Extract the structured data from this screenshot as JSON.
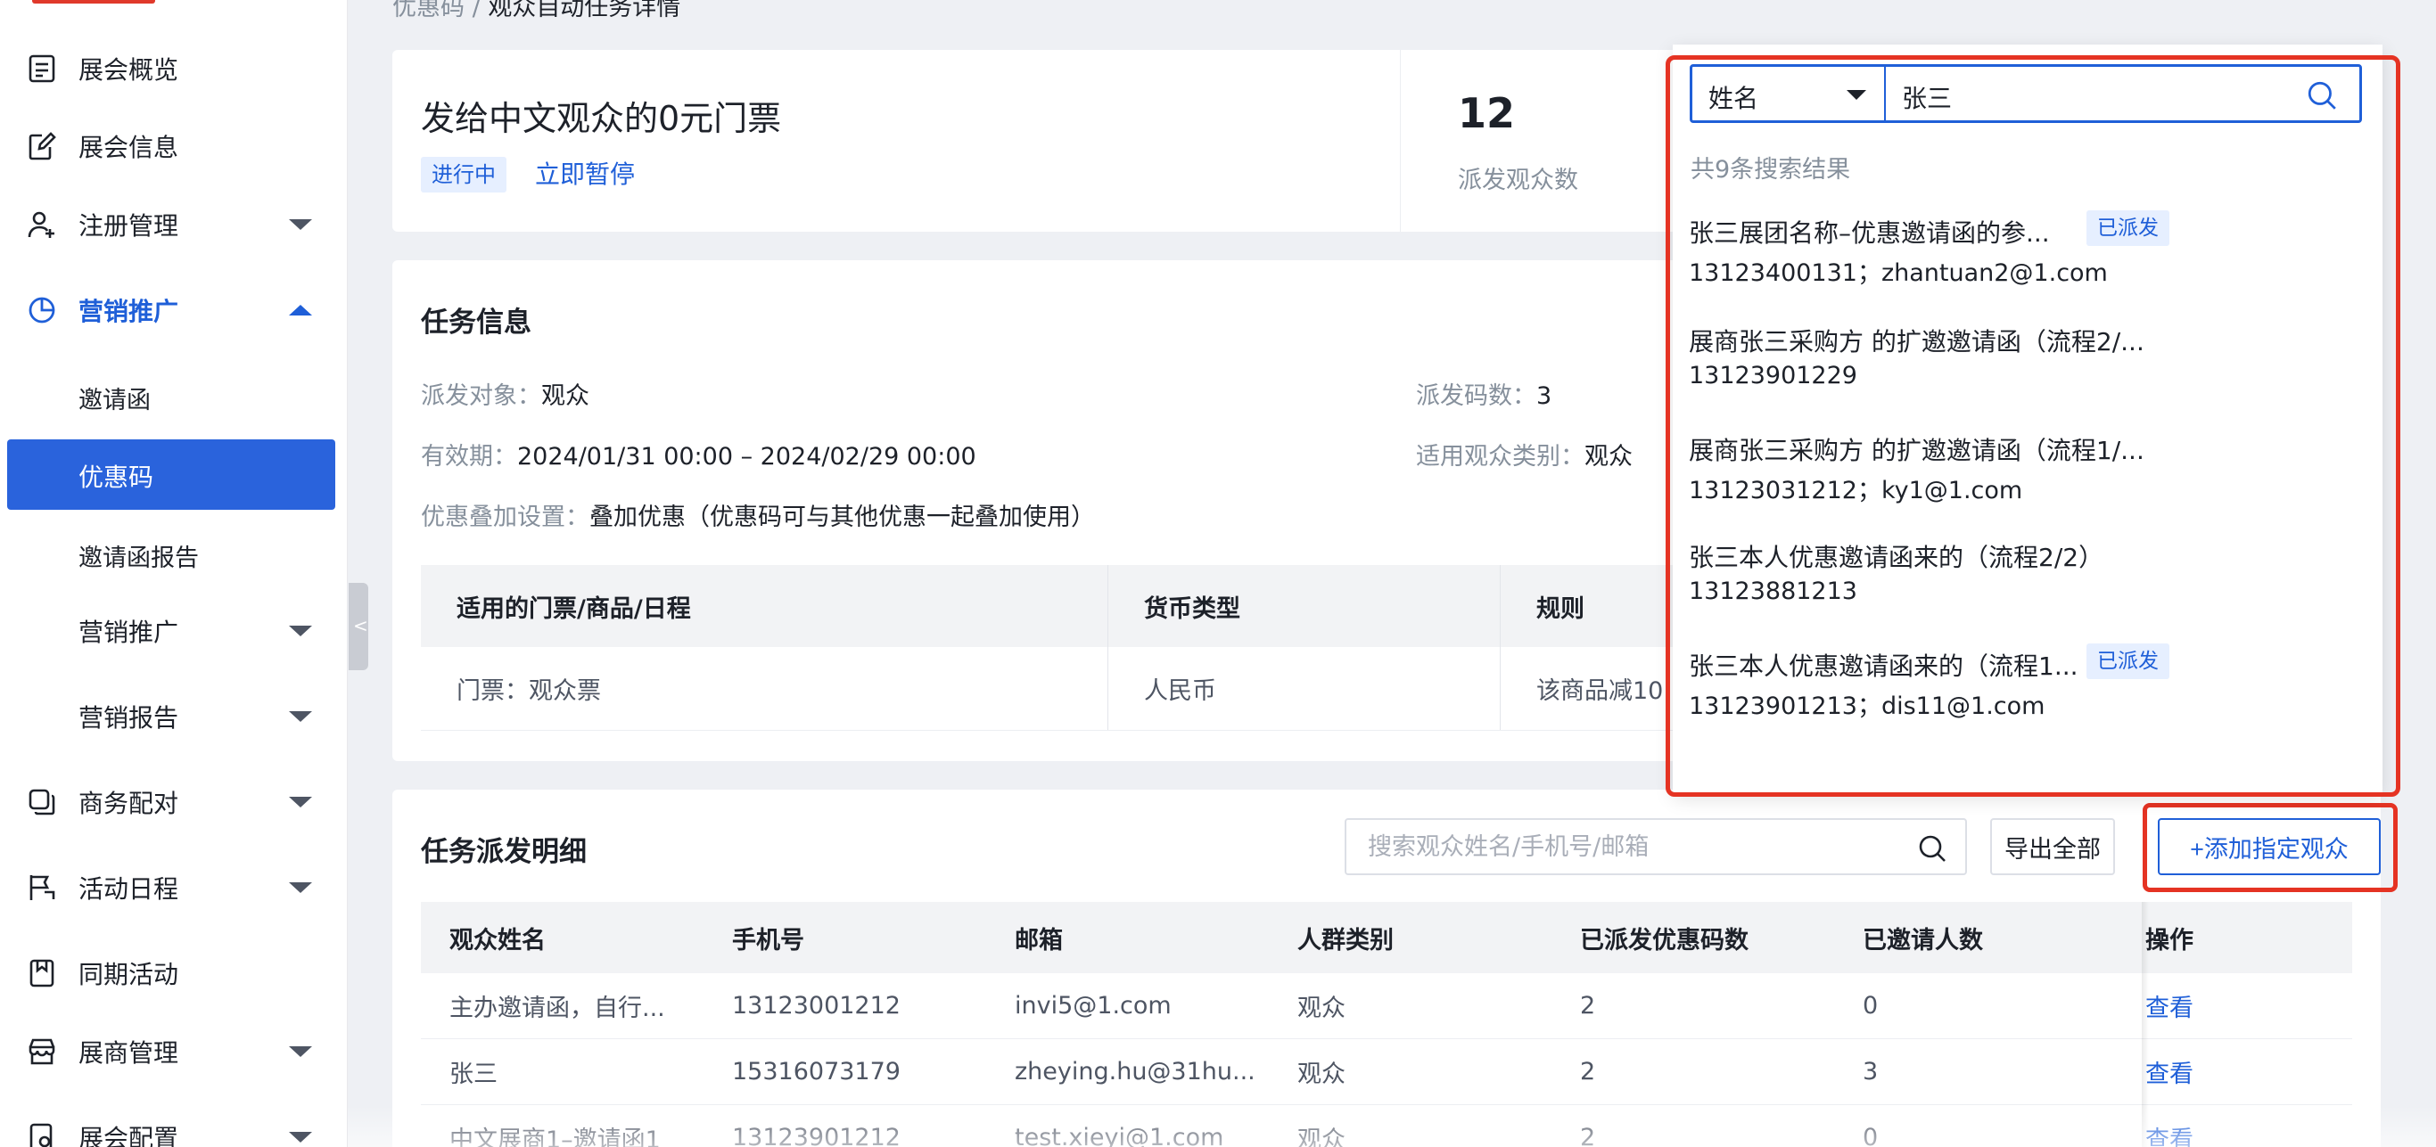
{
  "sidebar": {
    "items": [
      {
        "label": "展会概览",
        "icon": "overview-icon"
      },
      {
        "label": "展会信息",
        "icon": "edit-doc-icon"
      },
      {
        "label": "注册管理",
        "icon": "user-add-icon"
      },
      {
        "label": "营销推广",
        "icon": "pie-chart-icon"
      },
      {
        "label": "商务配对",
        "icon": "copy-icon"
      },
      {
        "label": "活动日程",
        "icon": "flag-icon"
      },
      {
        "label": "同期活动",
        "icon": "bookmark-icon"
      },
      {
        "label": "展商管理",
        "icon": "store-icon"
      },
      {
        "label": "展会配置",
        "icon": "settings-doc-icon"
      }
    ],
    "sub_items": [
      "邀请函",
      "优惠码",
      "邀请函报告",
      "营销推广",
      "营销报告"
    ]
  },
  "breadcrumb": {
    "parent": "优惠码",
    "separator": "/",
    "current": "观众自动任务详情"
  },
  "summary": {
    "title": "发给中文观众的0元门票",
    "status": "进行中",
    "pause_label": "立即暂停",
    "stat_value": "12",
    "stat_label": "派发观众数"
  },
  "task_info": {
    "title": "任务信息",
    "target_key": "派发对象：",
    "target_value": "观众",
    "validity_key": "有效期：",
    "validity_value": "2024/01/31 00:00 – 2024/02/29 00:00",
    "stack_key": "优惠叠加设置：",
    "stack_value": "叠加优惠（优惠码可与其他优惠一起叠加使用）",
    "count_key": "派发码数：",
    "count_value": "3",
    "category_key": "适用观众类别：",
    "category_value": "观众",
    "table": {
      "headers": [
        "适用的门票/商品/日程",
        "货币类型",
        "规则"
      ],
      "row": [
        "门票：观众票",
        "人民币",
        "该商品减10."
      ]
    }
  },
  "detail": {
    "title": "任务派发明细",
    "search_placeholder": "搜索观众姓名/手机号/邮箱",
    "export_label": "导出全部",
    "add_label": "+添加指定观众",
    "headers": [
      "观众姓名",
      "手机号",
      "邮箱",
      "人群类别",
      "已派发优惠码数",
      "已邀请人数",
      "操作"
    ],
    "rows": [
      [
        "主办邀请函，自行...",
        "13123001212",
        "invi5@1.com",
        "观众",
        "2",
        "0",
        "查看"
      ],
      [
        "张三",
        "15316073179",
        "zheying.hu@31hu...",
        "观众",
        "2",
        "3",
        "查看"
      ],
      [
        "中文展商1–邀请函1",
        "13123901212",
        "test.xieyi@1.com",
        "观众",
        "2",
        "0",
        "查看"
      ]
    ]
  },
  "search_panel": {
    "field": "姓名",
    "query": "张三",
    "result_count": "共9条搜索结果",
    "results": [
      {
        "name": "张三展团名称–优惠邀请函的参...",
        "tag": "已派发",
        "meta": "13123400131；zhantuan2@1.com"
      },
      {
        "name": "展商张三采购方 的扩邀邀请函（流程2/...",
        "tag": "",
        "meta": "13123901229"
      },
      {
        "name": "展商张三采购方 的扩邀邀请函（流程1/...",
        "tag": "",
        "meta": "13123031212；ky1@1.com"
      },
      {
        "name": "张三本人优惠邀请函来的（流程2/2）",
        "tag": "",
        "meta": "13123881213"
      },
      {
        "name": "张三本人优惠邀请函来的（流程1...",
        "tag": "已派发",
        "meta": "13123901213；dis11@1.com"
      }
    ]
  },
  "colors": {
    "accent": "#1f5fd8",
    "highlight": "#e53323",
    "selected_bg": "#2a63dc"
  }
}
